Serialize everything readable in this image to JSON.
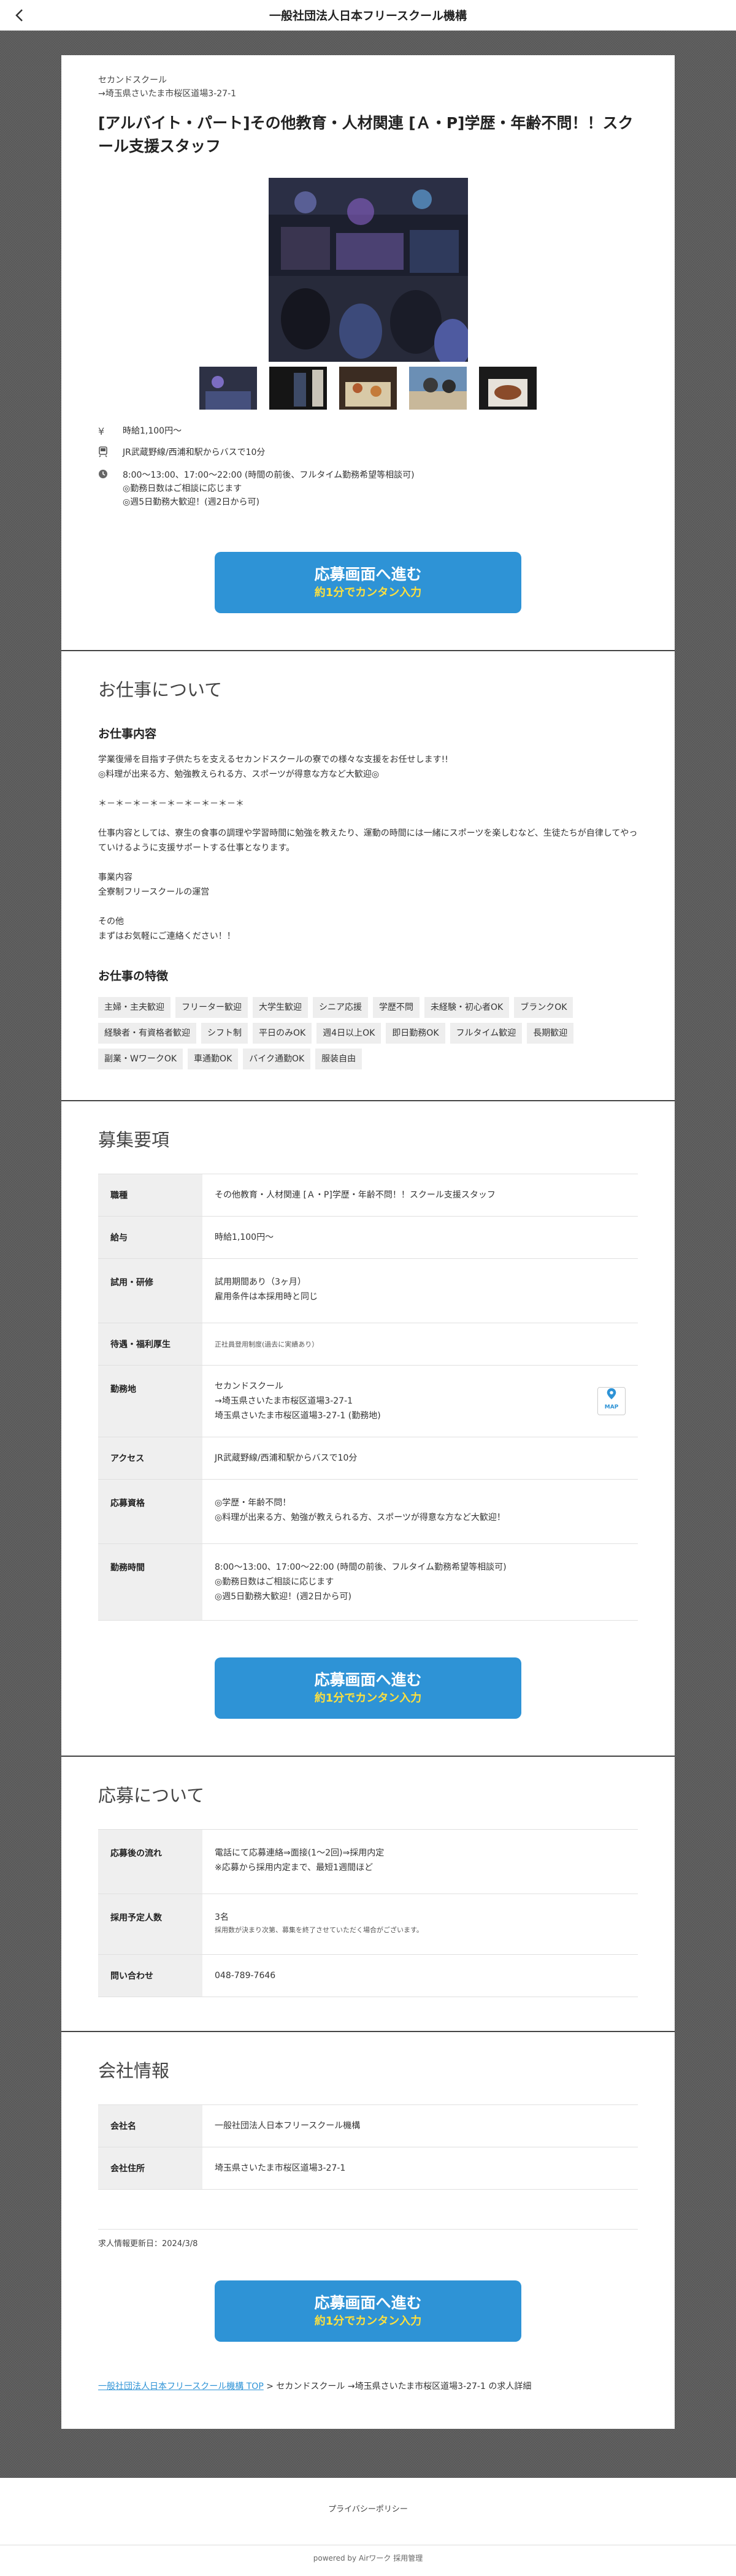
{
  "header": {
    "title": "一般社団法人日本フリースクール機構"
  },
  "job": {
    "company_line1": "セカンドスクール",
    "company_line2": "→埼玉県さいたま市桜区道場3-27-1",
    "title": "[アルバイト・パート]その他教育・人材関連 [Ａ・P]学歴・年齢不問！！スクール支援スタッフ",
    "salary": "時給1,100円〜",
    "access": "JR武蔵野線/西浦和駅からバスで10分",
    "hours": [
      "8:00〜13:00、17:00〜22:00 (時間の前後、フルタイム勤務希望等相談可)",
      "◎勤務日数はご相談に応じます",
      "◎週5日勤務大歓迎！(週2日から可)"
    ]
  },
  "cta": {
    "line1": "応募画面へ進む",
    "line2": "約1分でカンタン入力"
  },
  "work": {
    "heading": "お仕事について",
    "content_heading": "お仕事内容",
    "description": [
      "学業復帰を目指す子供たちを支えるセカンドスクールの寮での様々な支援をお任せします!!",
      "◎料理が出来る方、勉強教えられる方、スポーツが得意な方など大歓迎◎",
      "",
      "＊－＊－＊－＊－＊－＊－＊－＊－＊",
      "",
      "仕事内容としては、寮生の食事の調理や学習時間に勉強を教えたり、運動の時間には一緒にスポーツを楽しむなど、生徒たちが自律してやっていけるように支援サポートする仕事となります。",
      "",
      "事業内容",
      "全寮制フリースクールの運営",
      "",
      "その他",
      "まずはお気軽にご連絡ください！！"
    ],
    "features_heading": "お仕事の特徴",
    "tags": [
      "主婦・主夫歓迎",
      "フリーター歓迎",
      "大学生歓迎",
      "シニア応援",
      "学歴不問",
      "未経験・初心者OK",
      "ブランクOK",
      "経験者・有資格者歓迎",
      "シフト制",
      "平日のみOK",
      "週4日以上OK",
      "即日勤務OK",
      "フルタイム歓迎",
      "長期歓迎",
      "副業・WワークOK",
      "車通勤OK",
      "バイク通勤OK",
      "服装自由"
    ]
  },
  "recruit": {
    "heading": "募集要項",
    "rows": {
      "job_type": {
        "label": "職種",
        "value": "その他教育・人材関連 [Ａ・P]学歴・年齢不問！！スクール支援スタッフ"
      },
      "pay": {
        "label": "給与",
        "value": "時給1,100円〜"
      },
      "trial": {
        "label": "試用・研修",
        "line1": "試用期間あり（3ヶ月）",
        "line2": "雇用条件は本採用時と同じ"
      },
      "benefits": {
        "label": "待遇・福利厚生",
        "value": "正社員登用制度(過去に実績あり）"
      },
      "location": {
        "label": "勤務地",
        "line1": "セカンドスクール",
        "line2": "→埼玉県さいたま市桜区道場3-27-1",
        "line3": "埼玉県さいたま市桜区道場3-27-1 (勤務地)",
        "map_label": "MAP"
      },
      "access": {
        "label": "アクセス",
        "value": "JR武蔵野線/西浦和駅からバスで10分"
      },
      "qualify": {
        "label": "応募資格",
        "line1": "◎学歴・年齢不問！",
        "line2": "◎料理が出来る方、勉強が教えられる方、スポーツが得意な方など大歓迎！"
      },
      "hours": {
        "label": "勤務時間",
        "line1": "8:00〜13:00、17:00〜22:00 (時間の前後、フルタイム勤務希望等相談可)",
        "line2": "◎勤務日数はご相談に応じます",
        "line3": "◎週5日勤務大歓迎！(週2日から可)"
      }
    }
  },
  "apply": {
    "heading": "応募について",
    "rows": {
      "flow": {
        "label": "応募後の流れ",
        "line1": "電話にて応募連絡⇒面接(1〜2回)⇒採用内定",
        "line2": "※応募から採用内定まで、最短1週間ほど"
      },
      "count": {
        "label": "採用予定人数",
        "value": "3名",
        "note": "採用数が決まり次第、募集を終了させていただく場合がございます。"
      },
      "contact": {
        "label": "問い合わせ",
        "value": "048-789-7646"
      }
    }
  },
  "company": {
    "heading": "会社情報",
    "name_label": "会社名",
    "name_value": "一般社団法人日本フリースクール機構",
    "address_label": "会社住所",
    "address_value": "埼玉県さいたま市桜区道場3-27-1",
    "updated": "求人情報更新日：2024/3/8"
  },
  "breadcrumb": {
    "link": "一般社団法人日本フリースクール機構 TOP",
    "rest": " > セカンドスクール →埼玉県さいたま市桜区道場3-27-1 の求人詳細"
  },
  "footer": {
    "privacy": "プライバシーポリシー",
    "powered": "powered by Airワーク 採用管理"
  },
  "colors": {
    "accent": "#2e93d6",
    "cta_sub": "#ffe03d"
  },
  "icons": {
    "back": "chevron-left-icon",
    "salary": "yen-icon",
    "access": "train-icon",
    "hours": "clock-icon",
    "map": "map-pin-icon"
  }
}
